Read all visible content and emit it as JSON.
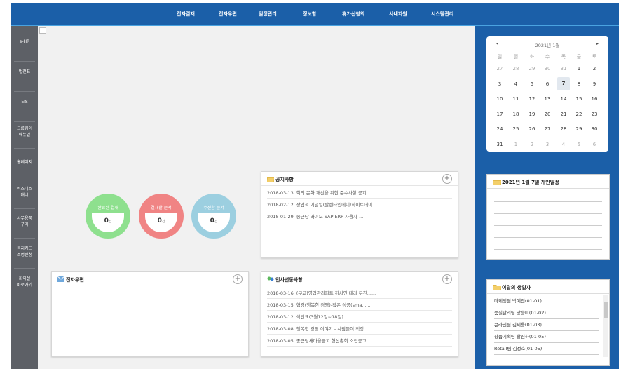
{
  "top_nav": [
    "전자결재",
    "전자우편",
    "일정관리",
    "정보함",
    "휴가신청의",
    "사내자원",
    "시스템관리"
  ],
  "side_nav": [
    {
      "lines": [
        "e-HR"
      ]
    },
    {
      "lines": [
        "법전표"
      ]
    },
    {
      "lines": [
        "EIS"
      ]
    },
    {
      "lines": [
        "그룹웨어",
        "매뉴얼"
      ]
    },
    {
      "lines": [
        "홈페이지"
      ]
    },
    {
      "lines": [
        "비즈니스",
        "매너"
      ]
    },
    {
      "lines": [
        "사무용품",
        "구매"
      ]
    },
    {
      "lines": [
        "복지카드",
        "소명신청"
      ]
    },
    {
      "lines": [
        "회의실",
        "바로가기"
      ]
    }
  ],
  "status_circles": [
    {
      "title": "완료된 결재",
      "count": "0",
      "unit": "건",
      "color": "#8ee08e"
    },
    {
      "title": "결재할 문서",
      "count": "0",
      "unit": "건",
      "color": "#f08484"
    },
    {
      "title": "수신함 문서",
      "count": "0",
      "unit": "건",
      "color": "#9ccfe0"
    }
  ],
  "notice": {
    "title": "공지사항",
    "rows": [
      {
        "date": "2018-03-13",
        "text": "회의 문화 개선을 위한 준수사항 공지"
      },
      {
        "date": "2018-02-12",
        "text": "상업적 기념일(발렌타인데이/화이트데이..."
      },
      {
        "date": "2018-01-29",
        "text": "종근당 바이오 SAP ERP 사용자 ..."
      }
    ]
  },
  "email": {
    "title": "전자우편"
  },
  "hr_notice": {
    "title": "인사변동사항",
    "rows": [
      {
        "date": "2018-03-16",
        "text": "(부고)영업관리파트 허서인 대리 부친......"
      },
      {
        "date": "2018-03-15",
        "text": "협경(행복한 경영)-작은 성공(sma......"
      },
      {
        "date": "2018-03-12",
        "text": "식단표(3월12일~18일)"
      },
      {
        "date": "2018-03-08",
        "text": "행복한 경영 이야기 - 사람들이 직장......"
      },
      {
        "date": "2018-03-05",
        "text": "종근당새마을금고 형산총회 소집공고"
      }
    ]
  },
  "calendar": {
    "month_label": "2021년 1월",
    "prev": "◂",
    "next": "▸",
    "weekdays": [
      "일",
      "월",
      "화",
      "수",
      "목",
      "금",
      "토"
    ],
    "weeks": [
      [
        {
          "d": "27",
          "m": true
        },
        {
          "d": "28",
          "m": true
        },
        {
          "d": "29",
          "m": true
        },
        {
          "d": "30",
          "m": true
        },
        {
          "d": "31",
          "m": true
        },
        {
          "d": "1"
        },
        {
          "d": "2"
        }
      ],
      [
        {
          "d": "3"
        },
        {
          "d": "4"
        },
        {
          "d": "5"
        },
        {
          "d": "6"
        },
        {
          "d": "7",
          "t": true
        },
        {
          "d": "8"
        },
        {
          "d": "9"
        }
      ],
      [
        {
          "d": "10"
        },
        {
          "d": "11"
        },
        {
          "d": "12"
        },
        {
          "d": "13"
        },
        {
          "d": "14"
        },
        {
          "d": "15"
        },
        {
          "d": "16"
        }
      ],
      [
        {
          "d": "17"
        },
        {
          "d": "18"
        },
        {
          "d": "19"
        },
        {
          "d": "20"
        },
        {
          "d": "21"
        },
        {
          "d": "22"
        },
        {
          "d": "23"
        }
      ],
      [
        {
          "d": "24"
        },
        {
          "d": "25"
        },
        {
          "d": "26"
        },
        {
          "d": "27"
        },
        {
          "d": "28"
        },
        {
          "d": "29"
        },
        {
          "d": "30"
        }
      ],
      [
        {
          "d": "31"
        },
        {
          "d": "1",
          "m": true
        },
        {
          "d": "2",
          "m": true
        },
        {
          "d": "3",
          "m": true
        },
        {
          "d": "4",
          "m": true
        },
        {
          "d": "5",
          "m": true
        },
        {
          "d": "6",
          "m": true
        }
      ]
    ]
  },
  "personal_schedule": {
    "title": "2021년 1월 7일 개인일정"
  },
  "birthdays": {
    "title": "이달의 생일자",
    "items": [
      "마케팅팀 박예진(01-01)",
      "품질관리팀 양승미(01-02)",
      "콘라인팀 김세용(01-03)",
      "상품기획팀 황진하(01-05)",
      "Retail팀 김정호(01-05)"
    ]
  },
  "colors": {
    "header": "#1b5fa8",
    "accent_line": "#4aa3e0",
    "sidebar": "#5d6066",
    "main_bg": "#f1f1f1"
  }
}
